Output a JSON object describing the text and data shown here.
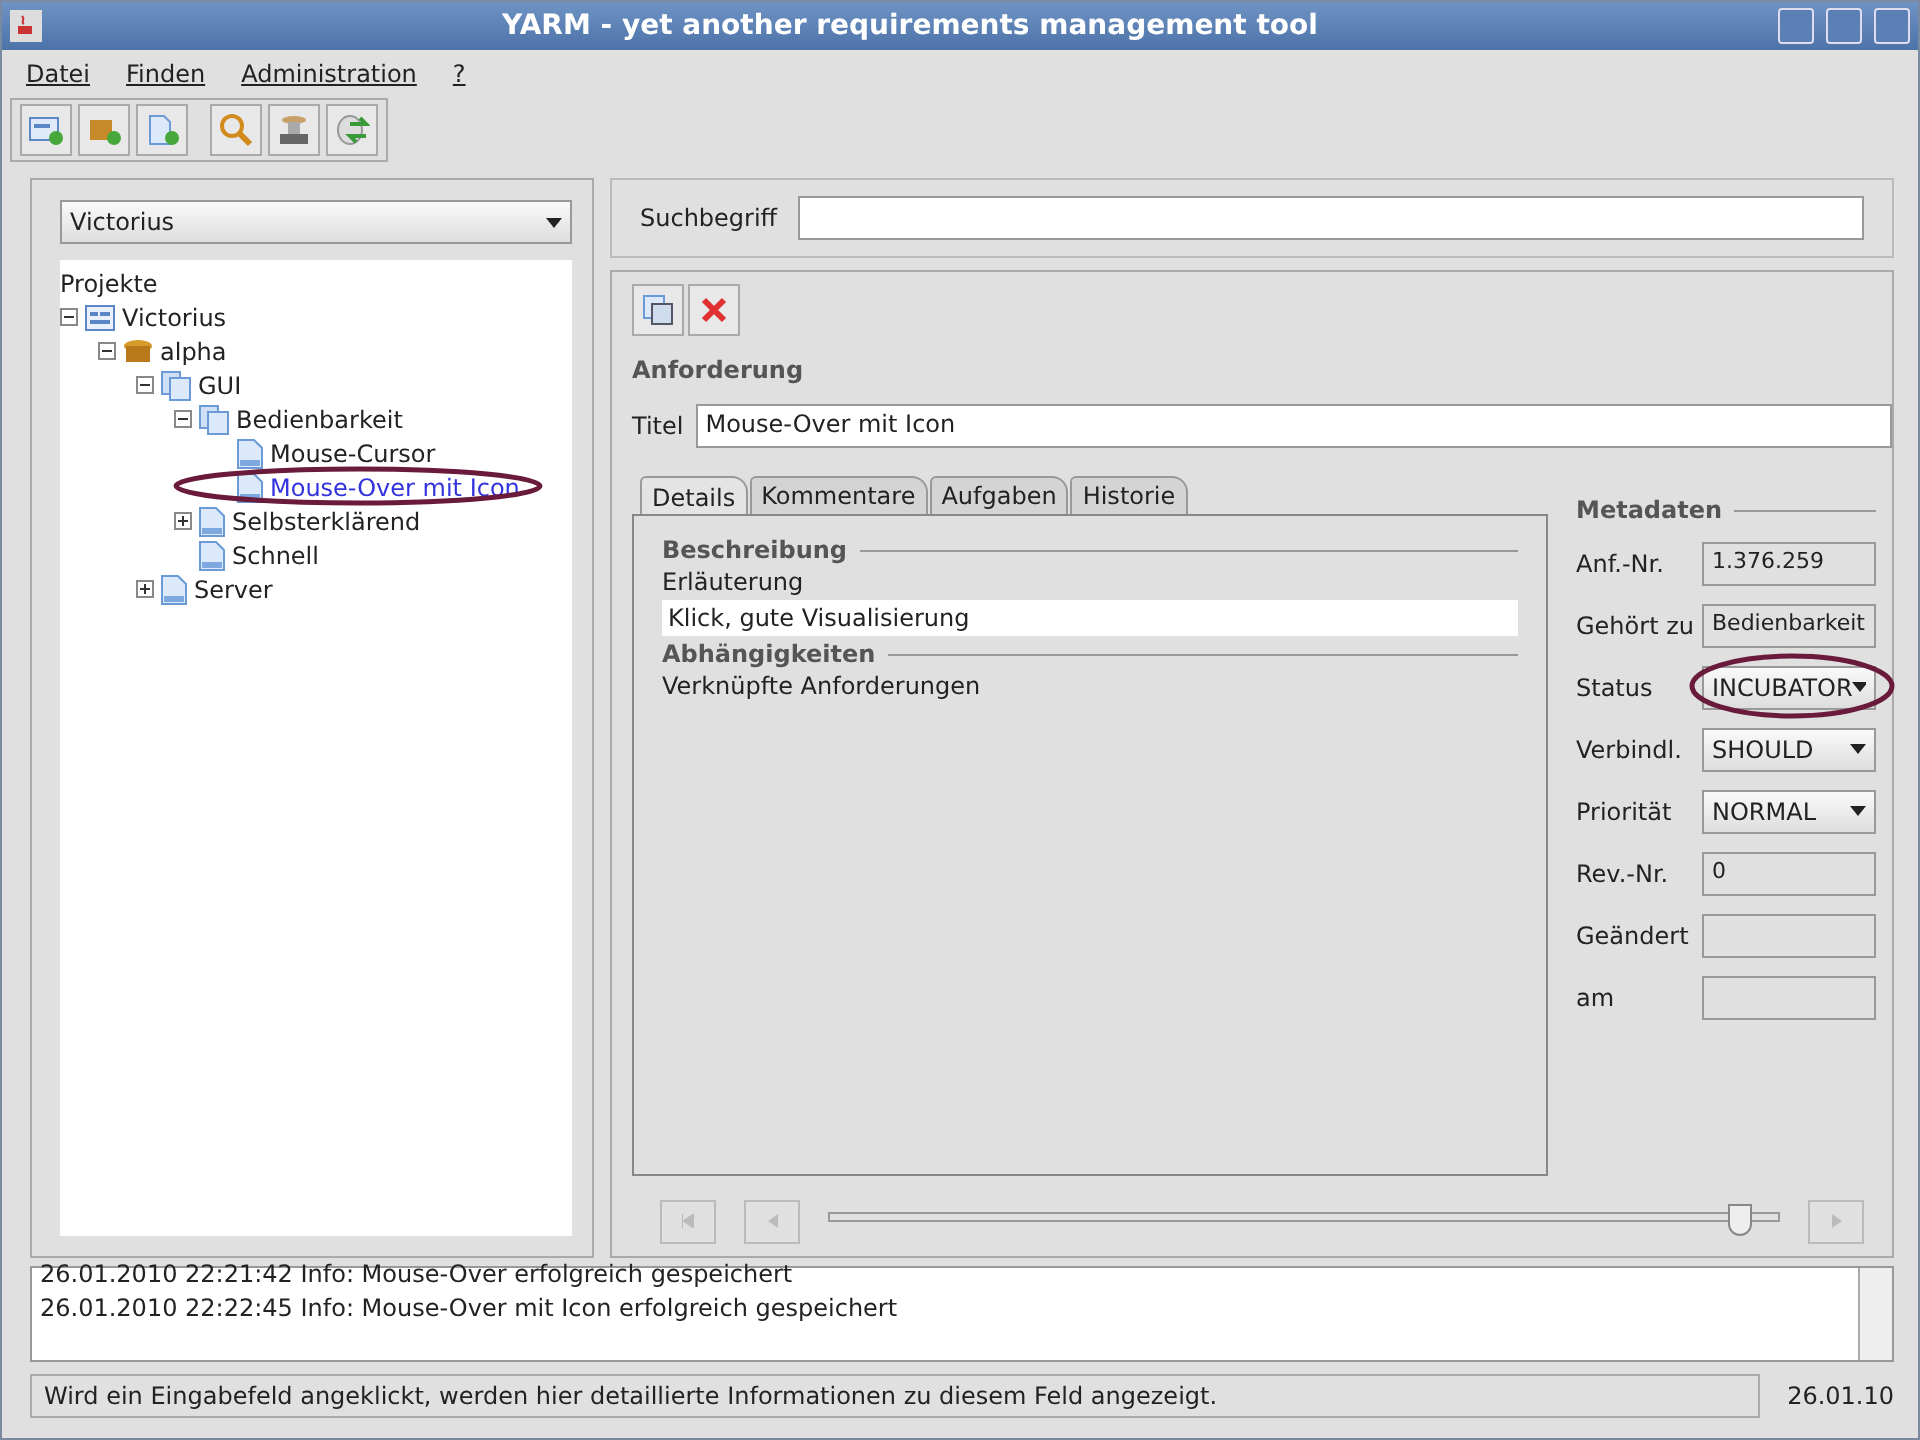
{
  "window": {
    "title": "YARM - yet another requirements management tool"
  },
  "menu": [
    "Datei",
    "Finden",
    "Administration",
    "?"
  ],
  "toolbar": [
    {
      "kind": "new-project"
    },
    {
      "kind": "new-package"
    },
    {
      "kind": "new-doc"
    },
    {
      "kind": "search"
    },
    {
      "kind": "db"
    },
    {
      "kind": "refresh"
    }
  ],
  "project_select": {
    "value": "Victorius"
  },
  "tree": {
    "root": "Projekte",
    "children": [
      {
        "label": "Victorius",
        "kind": "project",
        "expanded": true,
        "selected": false,
        "children": [
          {
            "label": "alpha",
            "kind": "package",
            "expanded": true,
            "selected": false,
            "children": [
              {
                "label": "GUI",
                "kind": "folder",
                "expanded": true,
                "selected": false,
                "children": [
                  {
                    "label": "Bedienbarkeit",
                    "kind": "folder",
                    "expanded": true,
                    "selected": false,
                    "children": [
                      {
                        "label": "Mouse-Cursor",
                        "kind": "doc",
                        "selected": false
                      },
                      {
                        "label": "Mouse-Over mit Icon",
                        "kind": "doc",
                        "selected": true,
                        "annotated": true
                      }
                    ]
                  },
                  {
                    "label": "Selbsterklärend",
                    "kind": "doc",
                    "expanded": false,
                    "selected": false
                  },
                  {
                    "label": "Schnell",
                    "kind": "doc",
                    "selected": false
                  }
                ]
              },
              {
                "label": "Server",
                "kind": "doc",
                "expanded": false,
                "selected": false
              }
            ]
          }
        ]
      }
    ]
  },
  "search": {
    "label": "Suchbegriff"
  },
  "requirement": {
    "heading": "Anforderung",
    "title_label": "Titel",
    "title_value": "Mouse-Over mit Icon"
  },
  "tabs": [
    {
      "label": "Details",
      "selected": true
    },
    {
      "label": "Kommentare",
      "selected": false
    },
    {
      "label": "Aufgaben",
      "selected": false
    },
    {
      "label": "Historie",
      "selected": false
    }
  ],
  "details": {
    "section_1": "Beschreibung",
    "description_label": "Erläuterung",
    "description_value": "Klick, gute Visualisierung",
    "section_2": "Abhängigkeiten",
    "links_label": "Verknüpfte Anforderungen"
  },
  "metadata": {
    "heading": "Metadaten",
    "rows": [
      {
        "label": "Anf.-Nr.",
        "kind": "field",
        "value": "1.376.259"
      },
      {
        "label": "Gehört zu",
        "kind": "field",
        "value": "Bedienbarkeit"
      },
      {
        "label": "Status",
        "kind": "select",
        "value": "INCUBATOR",
        "annotated": true
      },
      {
        "label": "Verbindl.",
        "kind": "select",
        "value": "SHOULD"
      },
      {
        "label": "Priorität",
        "kind": "select",
        "value": "NORMAL"
      },
      {
        "label": "Rev.-Nr.",
        "kind": "field",
        "value": "0"
      },
      {
        "label": "Geändert",
        "kind": "field"
      },
      {
        "label": "am",
        "kind": "field"
      }
    ]
  },
  "history_slider": {
    "level": 0.97
  },
  "log": [
    "26.01.2010 22:21:42 Info: Mouse-Over erfolgreich gespeichert",
    "26.01.2010 22:22:45 Info: Mouse-Over mit Icon erfolgreich gespeichert"
  ],
  "status_bar": {
    "message": "Wird ein Eingabefeld angeklickt, werden hier detaillierte Informationen zu diesem Feld angezeigt.",
    "date": "26.01.10"
  }
}
